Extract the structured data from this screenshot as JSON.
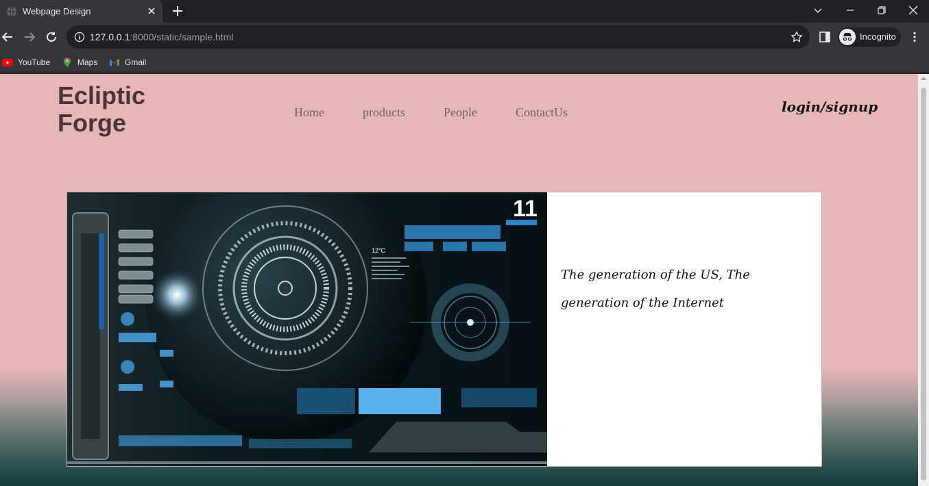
{
  "browser": {
    "tab_title": "Webpage Design",
    "url_host": "127.0.0.1",
    "url_rest": ":8000/static/sample.html",
    "profile_label": "Incognito",
    "bookmarks": [
      {
        "label": "YouTube",
        "icon": "youtube-icon"
      },
      {
        "label": "Maps",
        "icon": "maps-icon"
      },
      {
        "label": "Gmail",
        "icon": "gmail-icon"
      }
    ]
  },
  "site": {
    "logo": "Ecliptic Forge",
    "nav": [
      "Home",
      "products",
      "People",
      "ContactUs"
    ],
    "login": "login/signup",
    "hero": {
      "clock_number": "11",
      "temperature": "12°C",
      "tagline": "The generation of the US, The generation of the Internet"
    }
  },
  "colors": {
    "page_bg_top": "#e6b7b6",
    "page_bg_bottom": "#0f3c3a",
    "logo_color": "#4a3536",
    "nav_color": "#6e6261",
    "chrome_dark": "#202124",
    "chrome_toolbar": "#35363a"
  }
}
